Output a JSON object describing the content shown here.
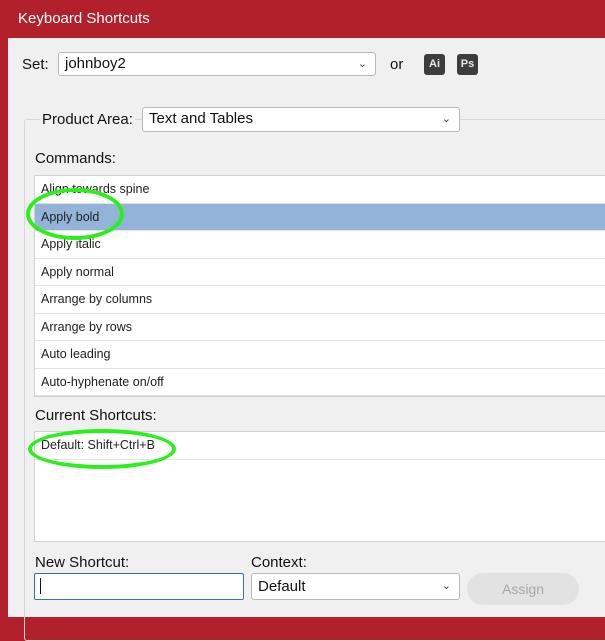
{
  "window": {
    "title": "Keyboard Shortcuts"
  },
  "set": {
    "label": "Set:",
    "value": "johnboy2",
    "or_label": "or",
    "icons": [
      {
        "name": "illustrator-icon",
        "text": "Ai"
      },
      {
        "name": "photoshop-icon",
        "text": "Ps"
      }
    ]
  },
  "product_area": {
    "label": "Product Area:",
    "value": "Text and Tables"
  },
  "commands": {
    "label": "Commands:",
    "items": [
      "Align towards spine",
      "Apply bold",
      "Apply italic",
      "Apply normal",
      "Arrange by columns",
      "Arrange by rows",
      "Auto leading",
      "Auto-hyphenate on/off"
    ],
    "selected_index": 1
  },
  "current_shortcuts": {
    "label": "Current Shortcuts:",
    "items": [
      "Default: Shift+Ctrl+B"
    ]
  },
  "new_shortcut": {
    "label": "New Shortcut:",
    "value": ""
  },
  "context": {
    "label": "Context:",
    "value": "Default"
  },
  "assign": {
    "label": "Assign"
  },
  "colors": {
    "titlebar": "#b2202c",
    "selection": "#93b4d8",
    "highlight": "#29f018"
  }
}
